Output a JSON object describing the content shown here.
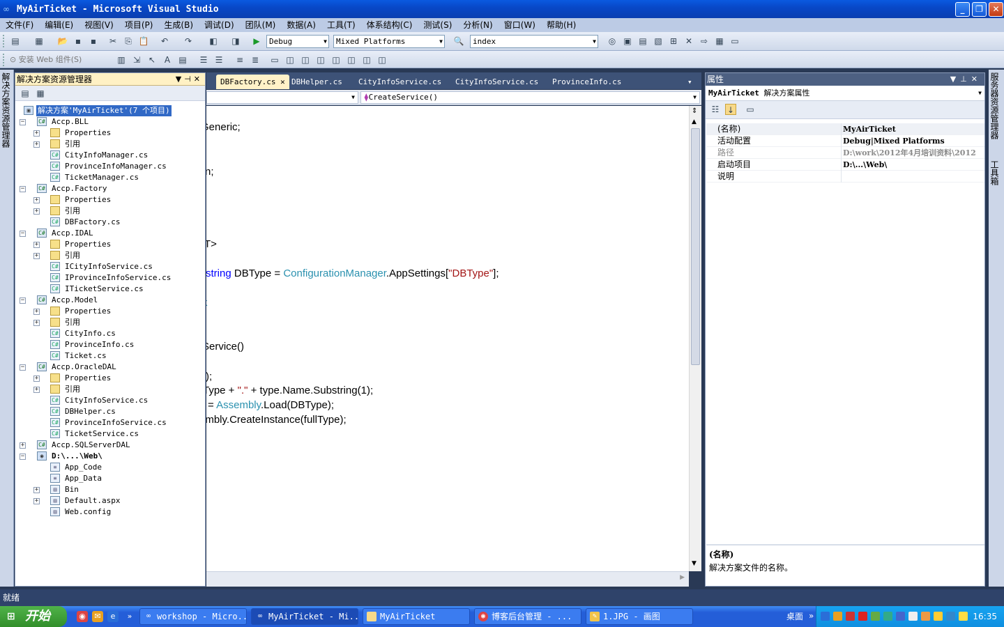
{
  "window": {
    "title": "MyAirTicket - Microsoft Visual Studio"
  },
  "menu": [
    "文件(F)",
    "编辑(E)",
    "视图(V)",
    "项目(P)",
    "生成(B)",
    "调试(D)",
    "团队(M)",
    "数据(A)",
    "工具(T)",
    "体系结构(C)",
    "测试(S)",
    "分析(N)",
    "窗口(W)",
    "帮助(H)"
  ],
  "toolbar": {
    "config": "Debug",
    "platform": "Mixed Platforms",
    "find": "index",
    "install_web": "安装 Web 组件(S)"
  },
  "left_dock_label": "解决方案资源管理器",
  "right_dock_labels": [
    "服务器资源管理器",
    "工具箱"
  ],
  "solution_explorer": {
    "title": "解决方案资源管理器",
    "solution_label": "解决方案'MyAirTicket'(7 个项目)",
    "items": [
      "Accp.BLL",
      "Properties",
      "引用",
      "CityInfoManager.cs",
      "ProvinceInfoManager.cs",
      "TicketManager.cs",
      "Accp.Factory",
      "Properties",
      "引用",
      "DBFactory.cs",
      "Accp.IDAL",
      "Properties",
      "引用",
      "ICityInfoService.cs",
      "IProvinceInfoService.cs",
      "ITicketService.cs",
      "Accp.Model",
      "Properties",
      "引用",
      "CityInfo.cs",
      "ProvinceInfo.cs",
      "Ticket.cs",
      "Accp.OracleDAL",
      "Properties",
      "引用",
      "CityInfoService.cs",
      "DBHelper.cs",
      "ProvinceInfoService.cs",
      "TicketService.cs",
      "Accp.SQLServerDAL",
      "D:\\...\\Web\\",
      "App_Code",
      "App_Data",
      "Bin",
      "Default.aspx",
      "Web.config"
    ]
  },
  "editor": {
    "tabs": [
      "DBFactory.cs",
      "DBHelper.cs",
      "CityInfoService.cs",
      "CityInfoService.cs",
      "ProvinceInfo.cs"
    ],
    "member_dropdown": "CreateService()",
    "code": {
      "l1": "Generic;",
      "l2": "n;",
      "l3": "T>",
      "l4a": "string",
      "l4b": " DBType = ",
      "l4c": "ConfigurationManager",
      "l4d": ".AppSettings[",
      "l4e": "\"DBType\"",
      "l4f": "];",
      "l5": "k",
      "l6": "Service()",
      "l7": ");",
      "l8a": "Type + ",
      "l8b": "\".\"",
      "l8c": " + type.Name.Substring(1);",
      "l9a": "= ",
      "l9b": "Assembly",
      "l9c": ".Load(DBType);",
      "l10": "embly.CreateInstance(fullType);"
    }
  },
  "properties": {
    "title": "属性",
    "object": "MyAirTicket",
    "object_desc": "解决方案属性",
    "rows": [
      {
        "name": "(名称)",
        "value": "MyAirTicket"
      },
      {
        "name": "活动配置",
        "value": "Debug|Mixed Platforms"
      },
      {
        "name": "路径",
        "value": "D:\\work\\2012年4月培训资料\\2012"
      },
      {
        "name": "启动项目",
        "value": "D:\\...\\Web\\"
      },
      {
        "name": "说明",
        "value": ""
      }
    ],
    "desc_title": "(名称)",
    "desc_text": "解决方案文件的名称。"
  },
  "status": "就绪",
  "taskbar": {
    "start": "开始",
    "tasks": [
      "workshop - Micro...",
      "MyAirTicket - Mi...",
      "MyAirTicket",
      "博客后台管理 - ...",
      "1.JPG - 画图"
    ],
    "desktop": "桌面",
    "clock": "16:35"
  }
}
